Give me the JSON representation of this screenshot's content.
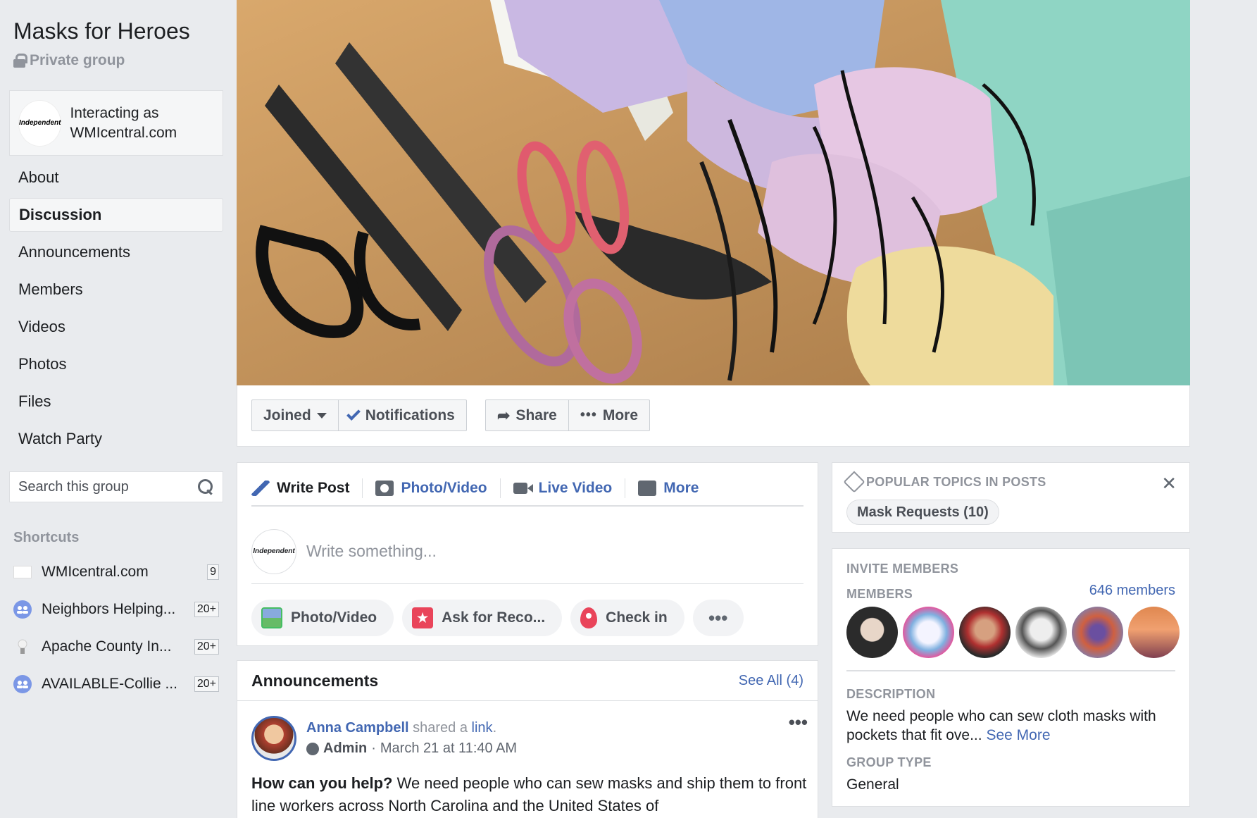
{
  "group": {
    "name": "Masks for Heroes",
    "privacy": "Private group",
    "interacting_as": "Interacting as WMIcentral.com",
    "logo_text": "Independent"
  },
  "nav": [
    {
      "label": "About",
      "active": false
    },
    {
      "label": "Discussion",
      "active": true
    },
    {
      "label": "Announcements",
      "active": false
    },
    {
      "label": "Members",
      "active": false
    },
    {
      "label": "Videos",
      "active": false
    },
    {
      "label": "Photos",
      "active": false
    },
    {
      "label": "Files",
      "active": false
    },
    {
      "label": "Watch Party",
      "active": false
    }
  ],
  "search": {
    "placeholder": "Search this group"
  },
  "shortcuts": {
    "label": "Shortcuts",
    "items": [
      {
        "label": "WMIcentral.com",
        "badge": "9",
        "icon": "site-logo-icon"
      },
      {
        "label": "Neighbors Helping...",
        "badge": "20+",
        "icon": "group-icon"
      },
      {
        "label": "Apache County In...",
        "badge": "20+",
        "icon": "lightbulb-icon"
      },
      {
        "label": "AVAILABLE-Collie ...",
        "badge": "20+",
        "icon": "group-icon"
      }
    ]
  },
  "actions": {
    "joined": "Joined",
    "notifications": "Notifications",
    "share": "Share",
    "more": "More"
  },
  "composer": {
    "tabs": [
      "Write Post",
      "Photo/Video",
      "Live Video",
      "More"
    ],
    "placeholder": "Write something...",
    "pills": [
      "Photo/Video",
      "Ask for Reco...",
      "Check in"
    ]
  },
  "announcements": {
    "title": "Announcements",
    "see_all": "See All (4)",
    "post": {
      "author": "Anna Campbell",
      "shared": "shared a",
      "link": "link",
      "role": "Admin",
      "time": "March 21 at 11:40 AM",
      "lead": "How can you help?",
      "body": "We need people who can sew masks and ship them to front line workers across North Carolina and the United States of"
    }
  },
  "topics": {
    "title": "POPULAR TOPICS IN POSTS",
    "chip": "Mask Requests (10)"
  },
  "about": {
    "invite_label": "INVITE MEMBERS",
    "members_label": "MEMBERS",
    "members_count": "646 members",
    "description_label": "DESCRIPTION",
    "description": "We need people who can sew cloth masks with pockets that fit ove...",
    "see_more": "See More",
    "type_label": "GROUP TYPE",
    "type": "General"
  },
  "colors": {
    "link": "#4267b2",
    "background": "#e9ebee",
    "muted": "#90949c"
  }
}
